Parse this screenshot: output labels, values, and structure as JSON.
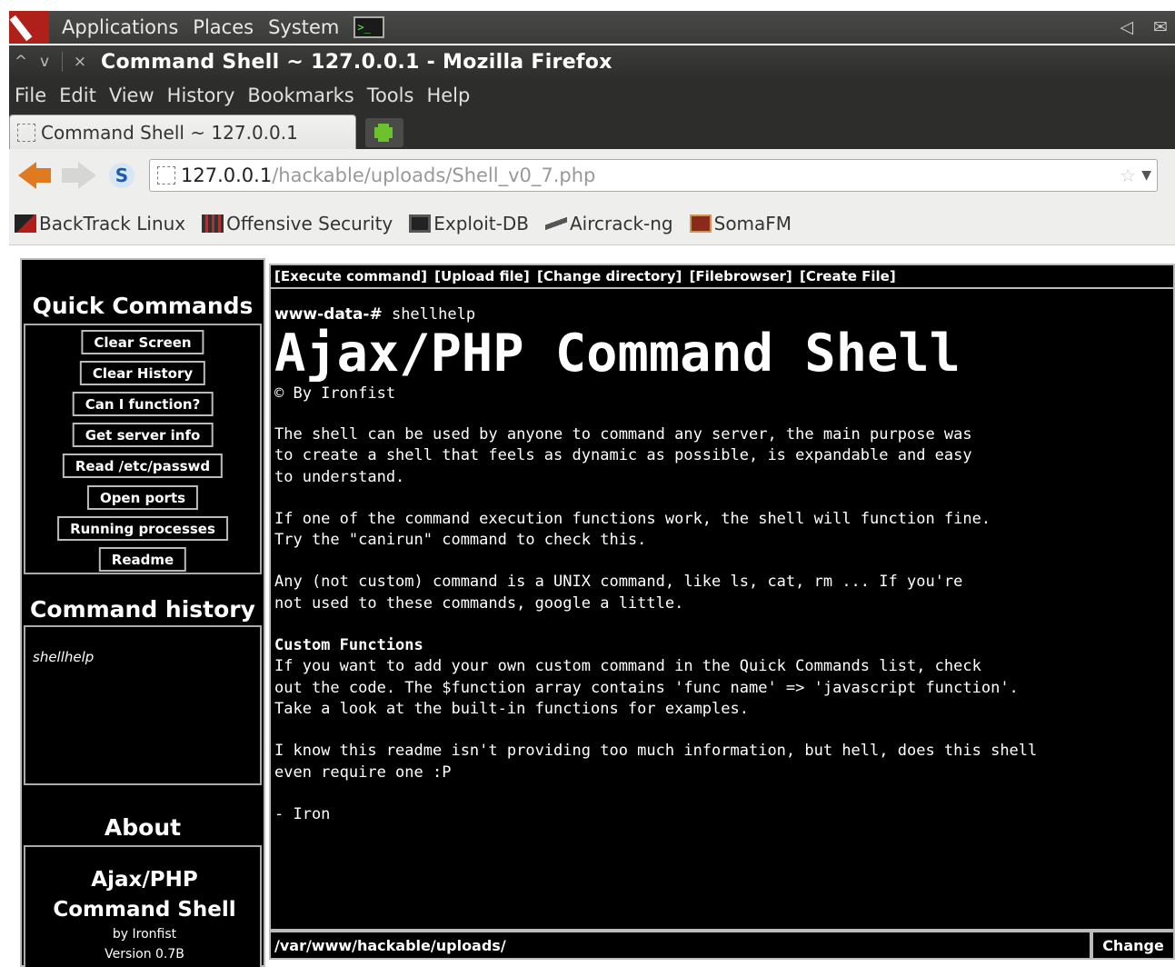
{
  "panel": {
    "menus": [
      "Applications",
      "Places",
      "System"
    ],
    "terminal_glyph": ">_",
    "tray": [
      "◁",
      "✉"
    ]
  },
  "window": {
    "controls": [
      "^",
      "v",
      "×"
    ],
    "title": "Command Shell ~ 127.0.0.1 - Mozilla Firefox"
  },
  "menubar": [
    "File",
    "Edit",
    "View",
    "History",
    "Bookmarks",
    "Tools",
    "Help"
  ],
  "tab": {
    "label": "Command Shell ~ 127.0.0.1"
  },
  "nav": {
    "s_glyph": "S",
    "url_host": "127.0.0.1",
    "url_path": "/hackable/uploads/Shell_v0_7.php",
    "star": "☆",
    "drop": "▼"
  },
  "bookmarks": [
    "BackTrack Linux",
    "Offensive Security",
    "Exploit-DB",
    "Aircrack-ng",
    "SomaFM"
  ],
  "sidebar": {
    "quick_commands_title": "Quick Commands",
    "buttons": [
      "Clear Screen",
      "Clear History",
      "Can I function?",
      "Get server info",
      "Read /etc/passwd",
      "Open ports",
      "Running processes",
      "Readme"
    ],
    "history_title": "Command history",
    "history_items": [
      "shellhelp"
    ],
    "about_title": "About",
    "about_name_1": "Ajax/PHP",
    "about_name_2": "Command Shell",
    "about_by": "by Ironfist",
    "about_version": "Version 0.7B"
  },
  "command_menu": [
    "[Execute command]",
    "[Upload file]",
    "[Change directory]",
    "[Filebrowser]",
    "[Create File]"
  ],
  "output": {
    "prompt_user": "www-data-#",
    "prompt_cmd": " shellhelp",
    "title": "Ajax/PHP Command Shell",
    "by": "© By Ironfist",
    "p1": "The shell can be used by anyone to command any server, the main purpose was\nto create a shell that feels as dynamic as possible, is expandable and easy\nto understand.",
    "p2": "If one of the command execution functions work, the shell will function fine.\nTry the \"canirun\" command to check this.",
    "p3": "Any (not custom) command is a UNIX command, like ls, cat, rm ... If you're\nnot used to these commands, google a little.",
    "p4_head": "Custom Functions",
    "p4": "If you want to add your own custom command in the Quick Commands list, check\nout the code. The $function array contains 'func name' => 'javascript function'.\nTake a look at the built-in functions for examples.",
    "p5": "I know this readme isn't providing too much information, but hell, does this shell\neven require one :P",
    "p6": "- Iron"
  },
  "cwd": {
    "value": "/var/www/hackable/uploads/",
    "button": "Change"
  }
}
